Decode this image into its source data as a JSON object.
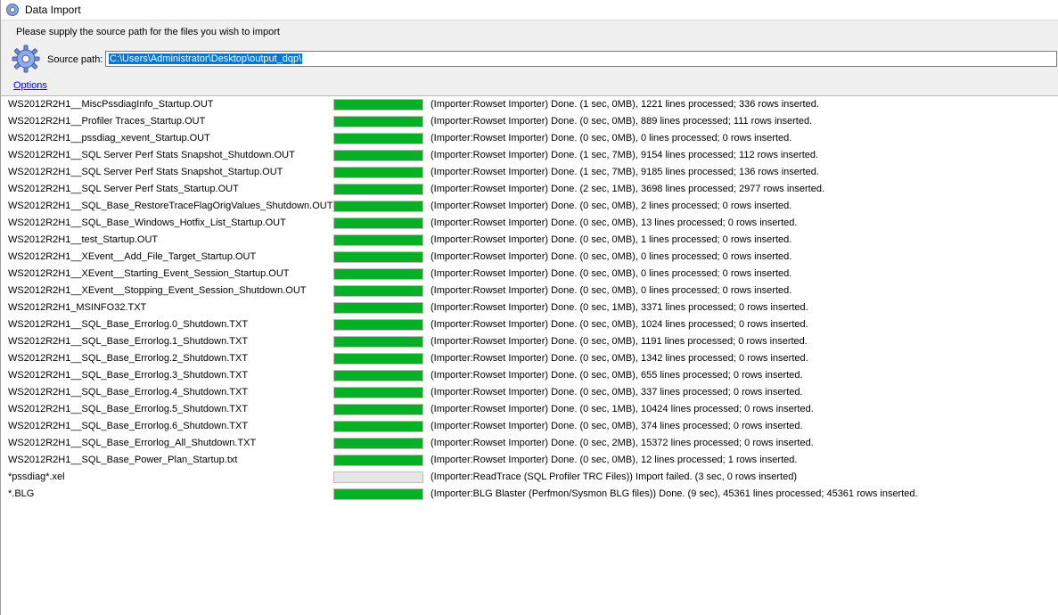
{
  "window": {
    "title": "Data Import"
  },
  "header": {
    "instruction": "Please supply the source path for the files you wish to import",
    "source_label": "Source path:",
    "source_path": "C:\\Users\\Administrator\\Desktop\\output_dqp\\",
    "options_label": "Options"
  },
  "colors": {
    "progress_fill": "#06b025",
    "selection": "#0078d7",
    "link": "#0000ee"
  },
  "files": [
    {
      "name": "WS2012R2H1__MiscPssdiagInfo_Startup.OUT",
      "progress": 1,
      "status": "(Importer:Rowset Importer) Done. (1 sec, 0MB), 1221 lines processed; 336 rows inserted."
    },
    {
      "name": "WS2012R2H1__Profiler Traces_Startup.OUT",
      "progress": 1,
      "status": "(Importer:Rowset Importer) Done. (0 sec, 0MB), 889 lines processed; 111 rows inserted."
    },
    {
      "name": "WS2012R2H1__pssdiag_xevent_Startup.OUT",
      "progress": 1,
      "status": "(Importer:Rowset Importer) Done. (0 sec, 0MB), 0 lines processed; 0 rows inserted."
    },
    {
      "name": "WS2012R2H1__SQL Server Perf Stats Snapshot_Shutdown.OUT",
      "progress": 1,
      "status": "(Importer:Rowset Importer) Done. (1 sec, 7MB), 9154 lines processed; 112 rows inserted."
    },
    {
      "name": "WS2012R2H1__SQL Server Perf Stats Snapshot_Startup.OUT",
      "progress": 1,
      "status": "(Importer:Rowset Importer) Done. (1 sec, 7MB), 9185 lines processed; 136 rows inserted."
    },
    {
      "name": "WS2012R2H1__SQL Server Perf Stats_Startup.OUT",
      "progress": 1,
      "status": "(Importer:Rowset Importer) Done. (2 sec, 1MB), 3698 lines processed; 2977 rows inserted."
    },
    {
      "name": "WS2012R2H1__SQL_Base_RestoreTraceFlagOrigValues_Shutdown.OUT",
      "progress": 1,
      "status": "(Importer:Rowset Importer) Done. (0 sec, 0MB), 2 lines processed; 0 rows inserted."
    },
    {
      "name": "WS2012R2H1__SQL_Base_Windows_Hotfix_List_Startup.OUT",
      "progress": 1,
      "status": "(Importer:Rowset Importer) Done. (0 sec, 0MB), 13 lines processed; 0 rows inserted."
    },
    {
      "name": "WS2012R2H1__test_Startup.OUT",
      "progress": 1,
      "status": "(Importer:Rowset Importer) Done. (0 sec, 0MB), 1 lines processed; 0 rows inserted."
    },
    {
      "name": "WS2012R2H1__XEvent__Add_File_Target_Startup.OUT",
      "progress": 1,
      "status": "(Importer:Rowset Importer) Done. (0 sec, 0MB), 0 lines processed; 0 rows inserted."
    },
    {
      "name": "WS2012R2H1__XEvent__Starting_Event_Session_Startup.OUT",
      "progress": 1,
      "status": "(Importer:Rowset Importer) Done. (0 sec, 0MB), 0 lines processed; 0 rows inserted."
    },
    {
      "name": "WS2012R2H1__XEvent__Stopping_Event_Session_Shutdown.OUT",
      "progress": 1,
      "status": "(Importer:Rowset Importer) Done. (0 sec, 0MB), 0 lines processed; 0 rows inserted."
    },
    {
      "name": "WS2012R2H1_MSINFO32.TXT",
      "progress": 1,
      "status": "(Importer:Rowset Importer) Done. (0 sec, 1MB), 3371 lines processed; 0 rows inserted."
    },
    {
      "name": "WS2012R2H1__SQL_Base_Errorlog.0_Shutdown.TXT",
      "progress": 1,
      "status": "(Importer:Rowset Importer) Done. (0 sec, 0MB), 1024 lines processed; 0 rows inserted."
    },
    {
      "name": "WS2012R2H1__SQL_Base_Errorlog.1_Shutdown.TXT",
      "progress": 1,
      "status": "(Importer:Rowset Importer) Done. (0 sec, 0MB), 1191 lines processed; 0 rows inserted."
    },
    {
      "name": "WS2012R2H1__SQL_Base_Errorlog.2_Shutdown.TXT",
      "progress": 1,
      "status": "(Importer:Rowset Importer) Done. (0 sec, 0MB), 1342 lines processed; 0 rows inserted."
    },
    {
      "name": "WS2012R2H1__SQL_Base_Errorlog.3_Shutdown.TXT",
      "progress": 1,
      "status": "(Importer:Rowset Importer) Done. (0 sec, 0MB), 655 lines processed; 0 rows inserted."
    },
    {
      "name": "WS2012R2H1__SQL_Base_Errorlog.4_Shutdown.TXT",
      "progress": 1,
      "status": "(Importer:Rowset Importer) Done. (0 sec, 0MB), 337 lines processed; 0 rows inserted."
    },
    {
      "name": "WS2012R2H1__SQL_Base_Errorlog.5_Shutdown.TXT",
      "progress": 1,
      "status": "(Importer:Rowset Importer) Done. (0 sec, 1MB), 10424 lines processed; 0 rows inserted."
    },
    {
      "name": "WS2012R2H1__SQL_Base_Errorlog.6_Shutdown.TXT",
      "progress": 1,
      "status": "(Importer:Rowset Importer) Done. (0 sec, 0MB), 374 lines processed; 0 rows inserted."
    },
    {
      "name": "WS2012R2H1__SQL_Base_Errorlog_All_Shutdown.TXT",
      "progress": 1,
      "status": "(Importer:Rowset Importer) Done. (0 sec, 2MB), 15372 lines processed; 0 rows inserted."
    },
    {
      "name": "WS2012R2H1__SQL_Base_Power_Plan_Startup.txt",
      "progress": 1,
      "status": "(Importer:Rowset Importer) Done. (0 sec, 0MB), 12 lines processed; 1 rows inserted."
    },
    {
      "name": "*pssdiag*.xel",
      "progress": 0,
      "status": "(Importer:ReadTrace (SQL Profiler TRC Files)) Import failed. (3 sec, 0 rows inserted)"
    },
    {
      "name": "*.BLG",
      "progress": 1,
      "status": "(Importer:BLG Blaster (Perfmon/Sysmon BLG files)) Done. (9 sec), 45361 lines processed; 45361 rows inserted."
    }
  ]
}
